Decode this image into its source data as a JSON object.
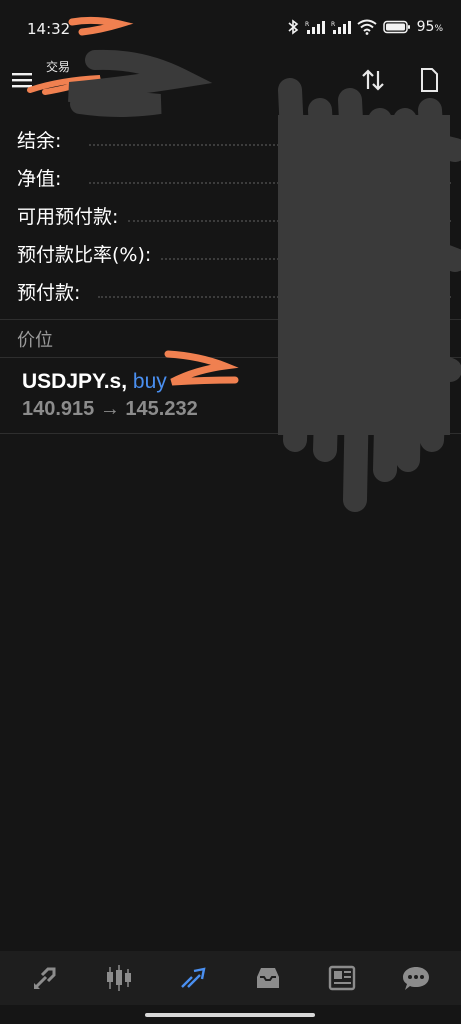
{
  "status_bar": {
    "time": "14:32",
    "battery_percent": "95",
    "battery_suffix": "%"
  },
  "app_bar": {
    "title": "交易",
    "menu_icon": "hamburger-menu-icon",
    "sort_icon": "sort-arrows-icon",
    "new_order_icon": "new-order-icon"
  },
  "account": {
    "balance_label": "结余:",
    "equity_label": "净值:",
    "free_margin_label": "可用预付款:",
    "margin_level_label": "预付款比率(%):",
    "margin_label": "预付款:"
  },
  "positions": {
    "section_title": "价位",
    "items": [
      {
        "symbol": "USDJPY.s,",
        "type": "buy",
        "open_price": "140.915",
        "arrow": "→",
        "current_price": "145.232"
      }
    ]
  },
  "bottom_nav": {
    "items": [
      {
        "icon": "quotes-icon"
      },
      {
        "icon": "chart-icon"
      },
      {
        "icon": "trade-icon",
        "active": true
      },
      {
        "icon": "history-icon"
      },
      {
        "icon": "news-icon"
      },
      {
        "icon": "messages-icon"
      }
    ]
  },
  "colors": {
    "background": "#151515",
    "accent": "#4a8ff0",
    "muted_text": "#8c8c8c",
    "nav_background": "#1e1e1e",
    "redaction_orange": "#f08050",
    "redaction_gray": "#3a3a3a"
  }
}
